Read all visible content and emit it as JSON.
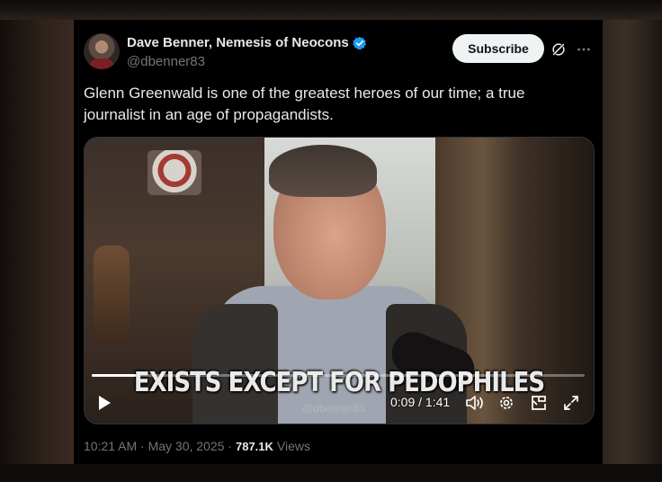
{
  "post": {
    "author_name": "Dave Benner, Nemesis of Neocons",
    "author_handle": "@dbenner83",
    "subscribe_label": "Subscribe",
    "text": "Glenn Greenwald is one of the greatest heroes of our time; a true journalist in an age of propagandists.",
    "timestamp": "10:21 AM · May 30, 2025 ·",
    "views_count": "787.1K",
    "views_label": "Views"
  },
  "video": {
    "caption": "EXISTS EXCEPT FOR PEDOPHILES",
    "watermark": "@dbenner83",
    "time_display": "0:09 / 1:41",
    "progress_fraction": 0.09
  },
  "icons": {
    "verified": "verified-badge-icon",
    "grok": "grok-icon",
    "more": "more-options-icon",
    "play": "play-icon",
    "volume": "volume-icon",
    "settings": "settings-icon",
    "pip": "picture-in-picture-icon",
    "fullscreen": "fullscreen-icon"
  },
  "colors": {
    "verified_blue": "#1d9bf0",
    "card_bg": "#000000",
    "text_primary": "#e7e9ea",
    "text_secondary": "#71767b",
    "subscribe_bg": "#eff3f4"
  }
}
